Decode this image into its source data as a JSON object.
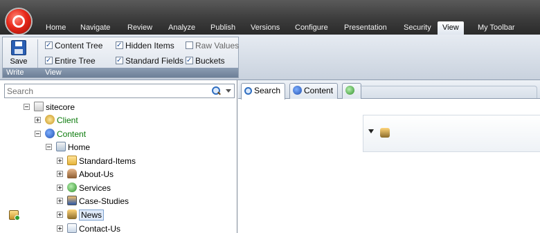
{
  "ribbon_tabs": [
    {
      "label": "Home"
    },
    {
      "label": "Navigate"
    },
    {
      "label": "Review"
    },
    {
      "label": "Analyze"
    },
    {
      "label": "Publish"
    },
    {
      "label": "Versions"
    },
    {
      "label": "Configure"
    },
    {
      "label": "Presentation"
    },
    {
      "label": "Security"
    },
    {
      "label": "View",
      "active": true
    },
    {
      "label": "My Toolbar"
    }
  ],
  "ribbon": {
    "save_label": "Save",
    "write_group_label": "Write",
    "view_group_label": "View",
    "checkboxes": [
      {
        "label": "Content Tree",
        "checked": true
      },
      {
        "label": "Hidden Items",
        "checked": true
      },
      {
        "label": "Raw Values",
        "checked": false
      },
      {
        "label": "Entire Tree",
        "checked": true
      },
      {
        "label": "Standard Fields",
        "checked": true
      },
      {
        "label": "Buckets",
        "checked": true
      }
    ]
  },
  "search": {
    "placeholder": "Search"
  },
  "tree": [
    {
      "label": "sitecore",
      "icon": "page-icon",
      "expanded": true
    },
    {
      "label": "Client",
      "icon": "client-icon",
      "expanded": false,
      "color": "#0a7a0a"
    },
    {
      "label": "Content",
      "icon": "content-icon",
      "expanded": true,
      "color": "#0a7a0a"
    },
    {
      "label": "Home",
      "icon": "home-icon",
      "expanded": true
    },
    {
      "label": "Standard-Items",
      "icon": "folder-icon",
      "expanded": false
    },
    {
      "label": "About-Us",
      "icon": "person-icon",
      "expanded": false
    },
    {
      "label": "Services",
      "icon": "globe-icon",
      "expanded": false
    },
    {
      "label": "Case-Studies",
      "icon": "book-icon",
      "expanded": false
    },
    {
      "label": "News",
      "icon": "news-icon",
      "expanded": false,
      "selected": true
    },
    {
      "label": "Contact-Us",
      "icon": "contact-icon",
      "expanded": false
    }
  ],
  "editor_tabs": [
    {
      "label": "Search",
      "icon": "search-icon",
      "active": true
    },
    {
      "label": "Content",
      "icon": "content-icon"
    },
    {
      "label": "",
      "icon": "add-tab-icon"
    }
  ]
}
